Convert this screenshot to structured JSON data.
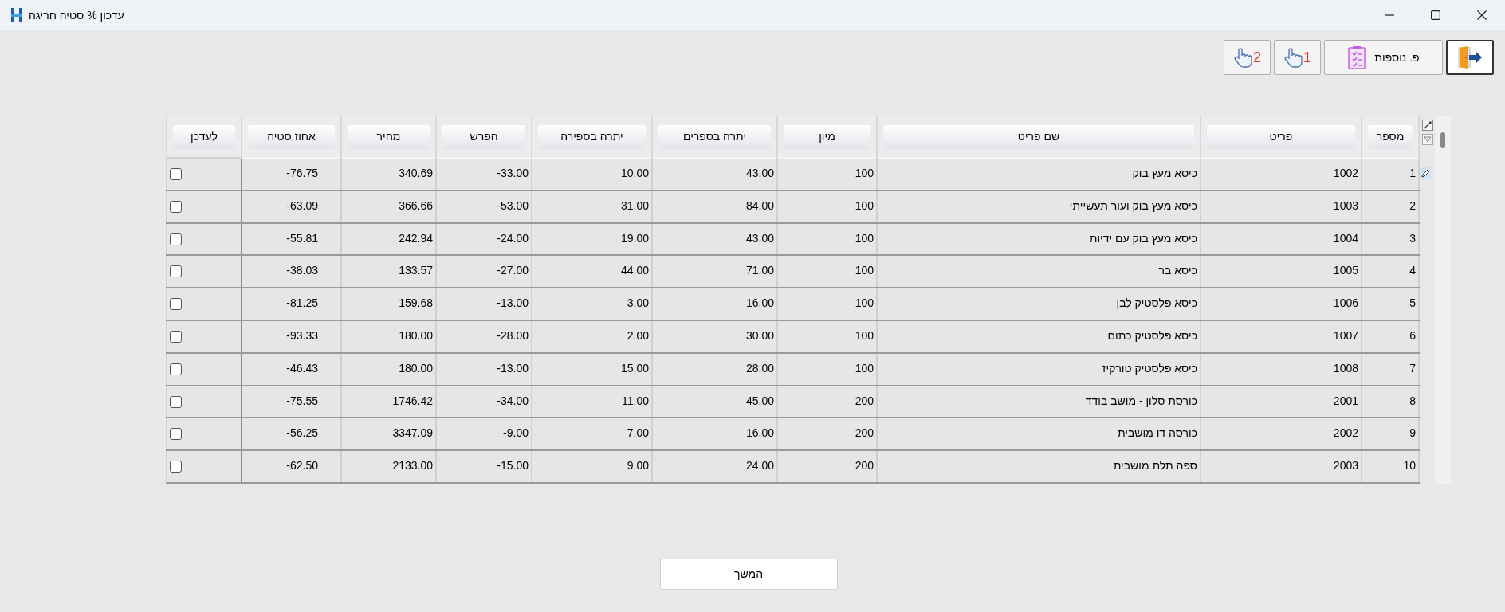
{
  "window": {
    "title": "עדכון % סטיה חריגה"
  },
  "toolbar": [
    {
      "kind": "hand",
      "label": "2"
    },
    {
      "kind": "hand",
      "label": "1"
    },
    {
      "kind": "more",
      "label": "פ. נוספות"
    },
    {
      "kind": "exit"
    }
  ],
  "table": {
    "columns": [
      "לעדכן",
      "אחוז סטיה",
      "מחיר",
      "הפרש",
      "יתרה בספירה",
      "יתרה בספרים",
      "מיון",
      "שם פריט",
      "פריט",
      "מספר"
    ],
    "rows": [
      {
        "checked": false,
        "cells": [
          "",
          "-76.75",
          "340.69",
          "-33.00",
          "10.00",
          "43.00",
          "100",
          "כיסא מעץ בוק",
          "1002",
          "1"
        ],
        "current": true
      },
      {
        "checked": false,
        "cells": [
          "",
          "-63.09",
          "366.66",
          "-53.00",
          "31.00",
          "84.00",
          "100",
          "כיסא מעץ בוק ועור תעשייתי",
          "1003",
          "2"
        ],
        "current": false
      },
      {
        "checked": false,
        "cells": [
          "",
          "-55.81",
          "242.94",
          "-24.00",
          "19.00",
          "43.00",
          "100",
          "כיסא מעץ בוק עם ידיות",
          "1004",
          "3"
        ],
        "current": false
      },
      {
        "checked": false,
        "cells": [
          "",
          "-38.03",
          "133.57",
          "-27.00",
          "44.00",
          "71.00",
          "100",
          "כיסא בר",
          "1005",
          "4"
        ],
        "current": false
      },
      {
        "checked": false,
        "cells": [
          "",
          "-81.25",
          "159.68",
          "-13.00",
          "3.00",
          "16.00",
          "100",
          "כיסא פלסטיק לבן",
          "1006",
          "5"
        ],
        "current": false
      },
      {
        "checked": false,
        "cells": [
          "",
          "-93.33",
          "180.00",
          "-28.00",
          "2.00",
          "30.00",
          "100",
          "כיסא פלסטיק כתום",
          "1007",
          "6"
        ],
        "current": false
      },
      {
        "checked": false,
        "cells": [
          "",
          "-46.43",
          "180.00",
          "-13.00",
          "15.00",
          "28.00",
          "100",
          "כיסא פלסטיק טורקיז",
          "1008",
          "7"
        ],
        "current": false
      },
      {
        "checked": false,
        "cells": [
          "",
          "-75.55",
          "1746.42",
          "-34.00",
          "11.00",
          "45.00",
          "200",
          "כורסת סלון - מושב בודד",
          "2001",
          "8"
        ],
        "current": false
      },
      {
        "checked": false,
        "cells": [
          "",
          "-56.25",
          "3347.09",
          "-9.00",
          "7.00",
          "16.00",
          "200",
          "כורסה דו מושבית",
          "2002",
          "9"
        ],
        "current": false
      },
      {
        "checked": false,
        "cells": [
          "",
          "-62.50",
          "2133.00",
          "-15.00",
          "9.00",
          "24.00",
          "200",
          "ספה תלת מושבית",
          "2003",
          "10"
        ],
        "current": false
      }
    ]
  },
  "continue_button": "המשך"
}
